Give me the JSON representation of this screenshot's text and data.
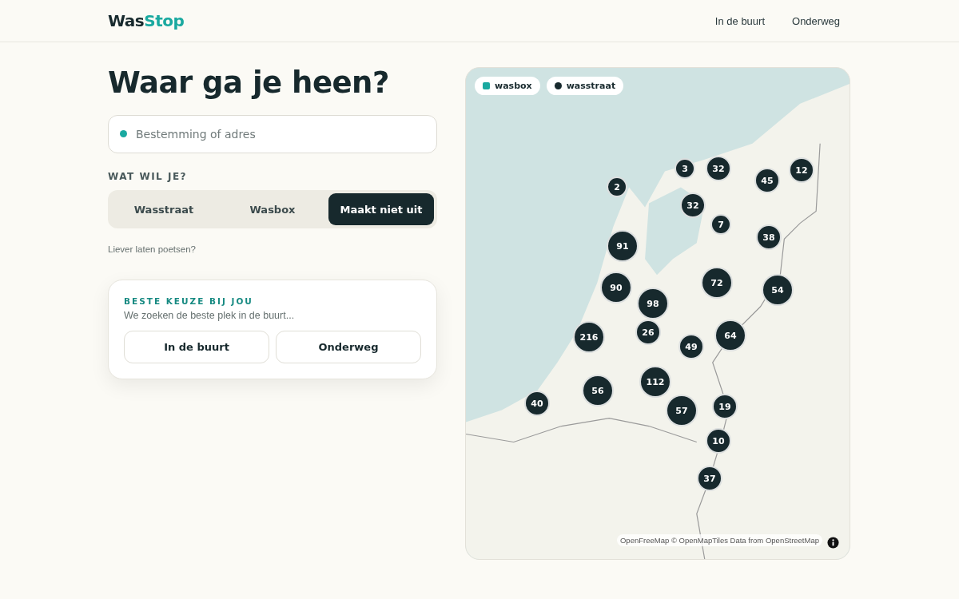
{
  "header": {
    "logo": {
      "part_1": "Was",
      "part_2": "Stop"
    },
    "nav": [
      "In de buurt",
      "Onderweg"
    ]
  },
  "search": {
    "title": "Waar ga je heen?",
    "placeholder": "Bestemming of adres"
  },
  "choice": {
    "label": "WAT WIL JE?",
    "options": [
      {
        "label": "Wasstraat",
        "selected": false
      },
      {
        "label": "Wasbox",
        "selected": false
      },
      {
        "label": "Maakt niet uit",
        "selected": true
      }
    ],
    "link": "Liever laten poetsen?"
  },
  "best_card": {
    "title": "BESTE KEUZE BIJ JOU",
    "text": "We zoeken de beste plek in de buurt...",
    "buttons": [
      "In de buurt",
      "Onderweg"
    ]
  },
  "map": {
    "legend": [
      {
        "label": "wasbox",
        "kind": "square",
        "color": "#1aa9a0"
      },
      {
        "label": "wasstraat",
        "kind": "circle",
        "color": "#17292d"
      }
    ],
    "clusters": [
      "2",
      "3",
      "32",
      "45",
      "12",
      "32",
      "7",
      "38",
      "91",
      "90",
      "98",
      "72",
      "54",
      "216",
      "26",
      "49",
      "64",
      "40",
      "56",
      "112",
      "57",
      "19",
      "10",
      "37"
    ],
    "attribution": "OpenFreeMap © OpenMapTiles Data from OpenStreetMap"
  }
}
